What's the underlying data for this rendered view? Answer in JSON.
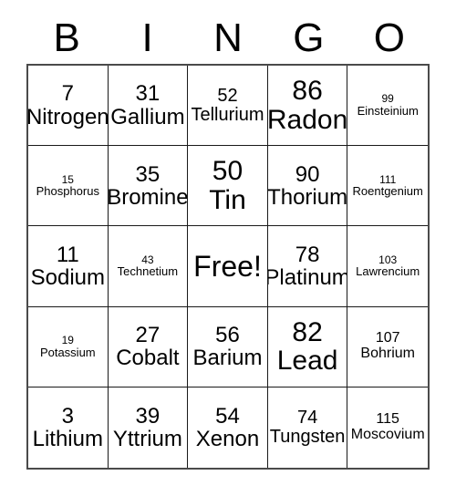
{
  "card": {
    "header_letters": [
      "B",
      "I",
      "N",
      "G",
      "O"
    ],
    "columns": 5,
    "rows": 5,
    "free_space_label": "Free!",
    "border_color": "#1a1a1a",
    "background_color": "#ffffff",
    "text_color": "#000000",
    "cells": [
      [
        {
          "number": "7",
          "name": "Nitrogen",
          "size": "lg",
          "free": false
        },
        {
          "number": "31",
          "name": "Gallium",
          "size": "lg",
          "free": false
        },
        {
          "number": "52",
          "name": "Tellurium",
          "size": "md",
          "free": false
        },
        {
          "number": "86",
          "name": "Radon",
          "size": "xl",
          "free": false
        },
        {
          "number": "99",
          "name": "Einsteinium",
          "size": "xs",
          "free": false
        }
      ],
      [
        {
          "number": "15",
          "name": "Phosphorus",
          "size": "xs",
          "free": false
        },
        {
          "number": "35",
          "name": "Bromine",
          "size": "lg",
          "free": false
        },
        {
          "number": "50",
          "name": "Tin",
          "size": "xl",
          "free": false
        },
        {
          "number": "90",
          "name": "Thorium",
          "size": "lg",
          "free": false
        },
        {
          "number": "111",
          "name": "Roentgenium",
          "size": "xs",
          "free": false
        }
      ],
      [
        {
          "number": "11",
          "name": "Sodium",
          "size": "lg",
          "free": false
        },
        {
          "number": "43",
          "name": "Technetium",
          "size": "xs",
          "free": false
        },
        {
          "number": "",
          "name": "Free!",
          "size": "xl",
          "free": true
        },
        {
          "number": "78",
          "name": "Platinum",
          "size": "lg",
          "free": false
        },
        {
          "number": "103",
          "name": "Lawrencium",
          "size": "xs",
          "free": false
        }
      ],
      [
        {
          "number": "19",
          "name": "Potassium",
          "size": "xs",
          "free": false
        },
        {
          "number": "27",
          "name": "Cobalt",
          "size": "lg",
          "free": false
        },
        {
          "number": "56",
          "name": "Barium",
          "size": "lg",
          "free": false
        },
        {
          "number": "82",
          "name": "Lead",
          "size": "xl",
          "free": false
        },
        {
          "number": "107",
          "name": "Bohrium",
          "size": "sm",
          "free": false
        }
      ],
      [
        {
          "number": "3",
          "name": "Lithium",
          "size": "lg",
          "free": false
        },
        {
          "number": "39",
          "name": "Yttrium",
          "size": "lg",
          "free": false
        },
        {
          "number": "54",
          "name": "Xenon",
          "size": "lg",
          "free": false
        },
        {
          "number": "74",
          "name": "Tungsten",
          "size": "md",
          "free": false
        },
        {
          "number": "115",
          "name": "Moscovium",
          "size": "sm",
          "free": false
        }
      ]
    ]
  }
}
